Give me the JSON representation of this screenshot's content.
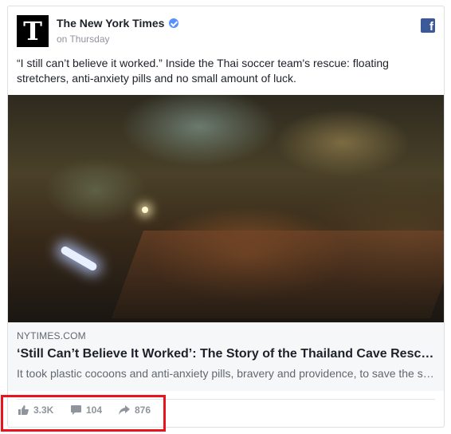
{
  "post": {
    "avatar_glyph": "T",
    "page_name": "The New York Times",
    "timestamp": "on Thursday",
    "message": "“I still can’t believe it worked.” Inside the Thai soccer team's rescue: floating stretchers, anti-anxiety pills and no small amount of luck.",
    "link": {
      "domain": "NYTIMES.COM",
      "headline": "‘Still Can’t Believe It Worked’: The Story of the Thailand Cave Rescue",
      "description": "It took plastic cocoons and anti-anxiety pills, bravery and providence, to save the soccer team."
    },
    "stats": {
      "likes": "3.3K",
      "comments": "104",
      "shares": "876"
    }
  },
  "icons": {
    "like": "thumbs-up-icon",
    "comment": "comment-bubble-icon",
    "share": "share-arrow-icon",
    "facebook": "facebook-icon"
  },
  "colors": {
    "verified": "#5890ff",
    "facebook": "#3b5998",
    "highlight": "#e8141e"
  }
}
